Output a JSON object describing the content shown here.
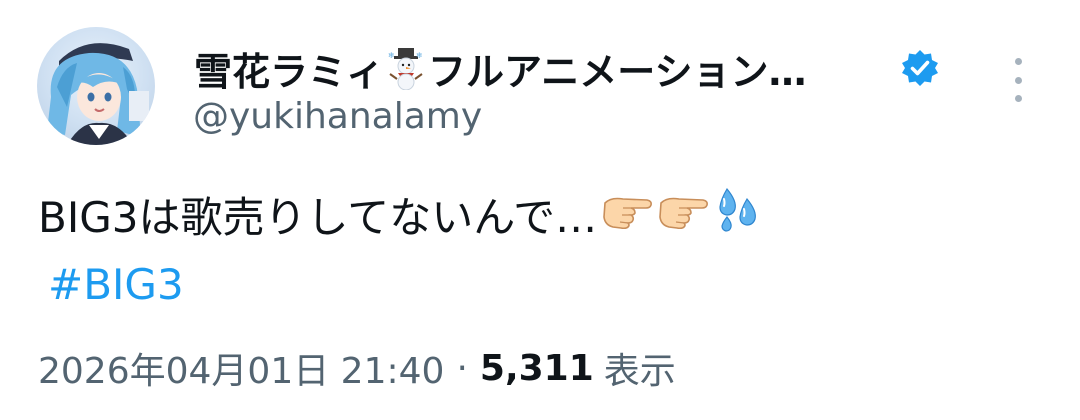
{
  "tweet": {
    "display_name": "雪花ラミィ",
    "display_name_suffix": "フルアニメーション…",
    "name_emoji": "snowman-icon",
    "verified_icon": "verified-badge-icon",
    "handle": "@yukihanalamy",
    "text": "BIG3は歌売りしてないんで…",
    "text_emojis": [
      "pointing-right-hand-icon",
      "pointing-right-hand-icon",
      "sweat-droplets-icon"
    ],
    "hashtag": "#BIG3",
    "timestamp": "2026年04月01日 21:40",
    "separator": "·",
    "views_count": "5,311",
    "views_label": "表示"
  },
  "colors": {
    "text": "#0f1419",
    "secondary": "#536471",
    "link": "#1d9bf0",
    "verified": "#1d9bf0",
    "more_dots": "#a6b2bd"
  }
}
